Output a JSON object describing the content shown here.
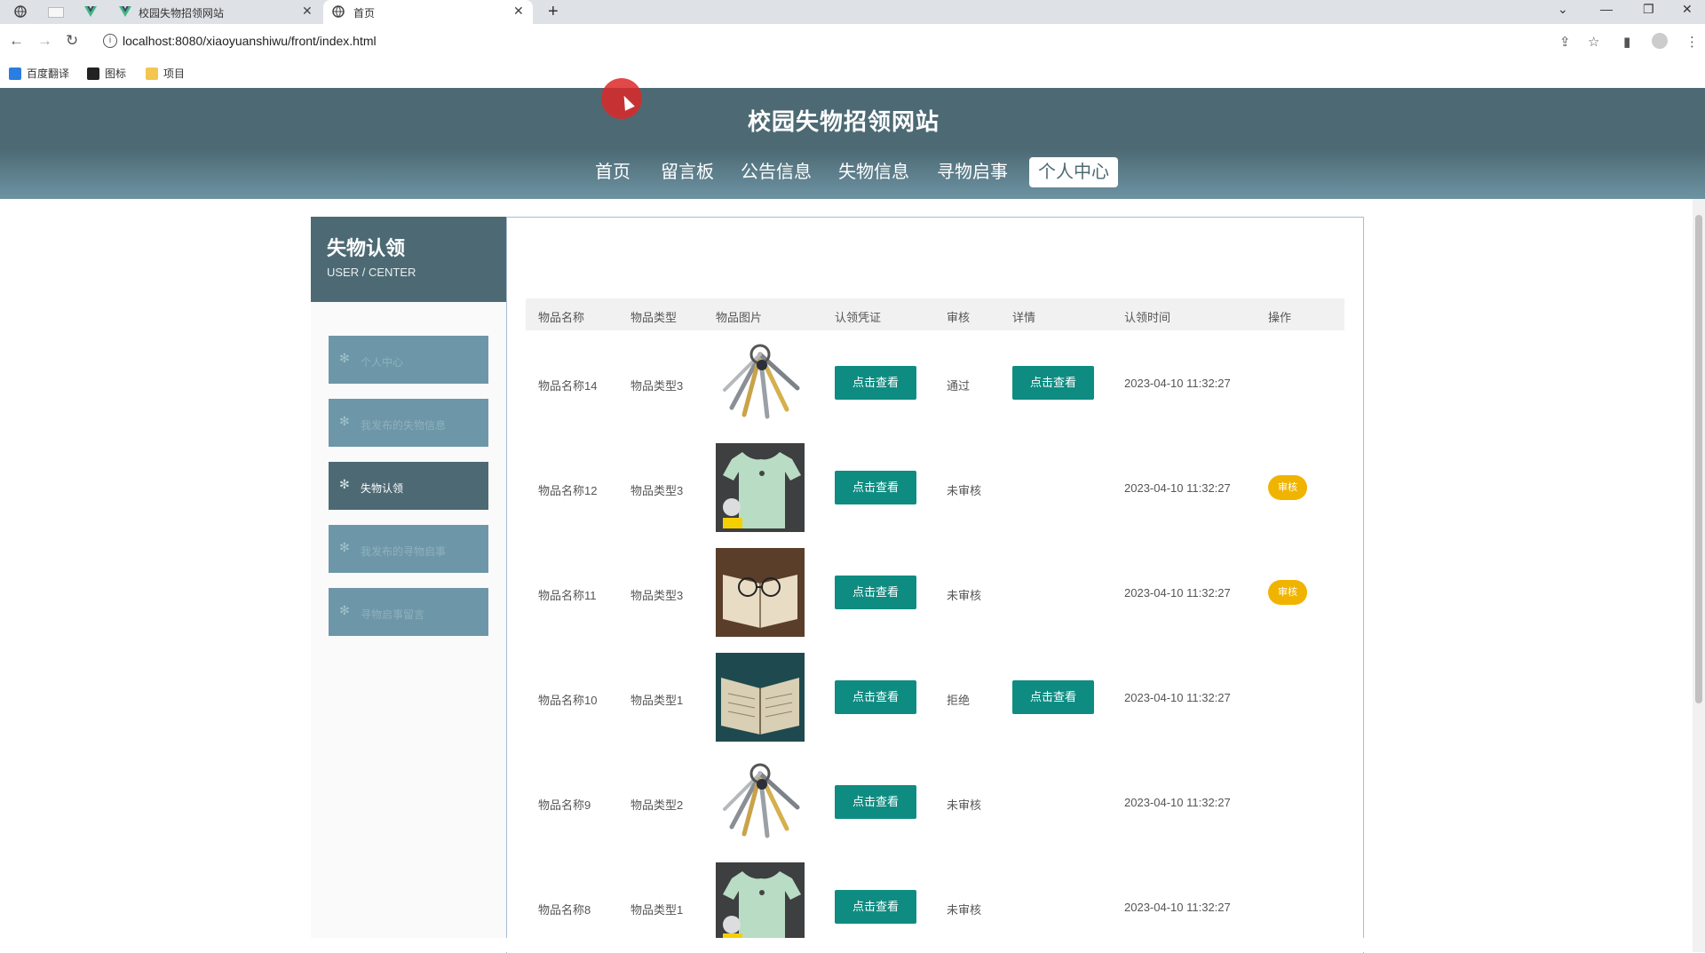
{
  "browser": {
    "tabs": [
      {
        "title": "校园失物招领网站"
      },
      {
        "title": "首页"
      }
    ],
    "url": "localhost:8080/xiaoyuanshiwu/front/index.html",
    "bookmarks": [
      "百度翻译",
      "图标",
      "项目"
    ]
  },
  "site": {
    "title": "校园失物招领网站",
    "menu": [
      "首页",
      "留言板",
      "公告信息",
      "失物信息",
      "寻物启事",
      "个人中心"
    ]
  },
  "sidebar": {
    "title": "失物认领",
    "subtitle": "USER / CENTER",
    "items": [
      {
        "label": "个人中心"
      },
      {
        "label": "我发布的失物信息"
      },
      {
        "label": "失物认领"
      },
      {
        "label": "我发布的寻物启事"
      },
      {
        "label": "寻物启事留言"
      }
    ]
  },
  "table": {
    "headers": [
      "物品名称",
      "物品类型",
      "物品图片",
      "认领凭证",
      "审核",
      "详情",
      "认领时间",
      "操作"
    ],
    "rows": [
      {
        "name": "物品名称14",
        "type": "物品类型3",
        "image": "keys",
        "proof": "点击查看",
        "status": "通过",
        "detail": "点击查看",
        "time": "2023-04-10 11:32:27",
        "action": ""
      },
      {
        "name": "物品名称12",
        "type": "物品类型3",
        "image": "tshirt",
        "proof": "点击查看",
        "status": "未审核",
        "detail": "",
        "time": "2023-04-10 11:32:27",
        "action": "审核"
      },
      {
        "name": "物品名称11",
        "type": "物品类型3",
        "image": "glasses-book",
        "proof": "点击查看",
        "status": "未审核",
        "detail": "",
        "time": "2023-04-10 11:32:27",
        "action": "审核"
      },
      {
        "name": "物品名称10",
        "type": "物品类型1",
        "image": "book",
        "proof": "点击查看",
        "status": "拒绝",
        "detail": "点击查看",
        "time": "2023-04-10 11:32:27",
        "action": ""
      },
      {
        "name": "物品名称9",
        "type": "物品类型2",
        "image": "keys",
        "proof": "点击查看",
        "status": "未审核",
        "detail": "",
        "time": "2023-04-10 11:32:27",
        "action": ""
      },
      {
        "name": "物品名称8",
        "type": "物品类型1",
        "image": "tshirt",
        "proof": "点击查看",
        "status": "未审核",
        "detail": "",
        "time": "2023-04-10 11:32:27",
        "action": ""
      }
    ]
  },
  "colors": {
    "header": "#4d6a74",
    "button": "#0f8c82",
    "badge": "#f0b400",
    "sidebar_item": "#6d97a8"
  }
}
